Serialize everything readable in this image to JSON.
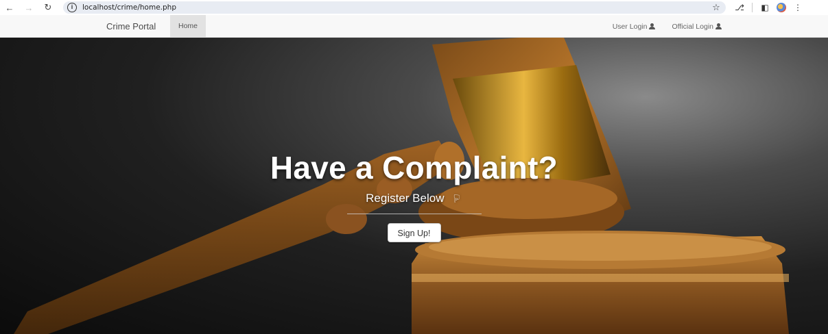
{
  "browser": {
    "url": "localhost/crime/home.php",
    "icons": [
      "back-arrow-icon",
      "forward-arrow-icon",
      "reload-icon",
      "site-info-icon",
      "bookmark-star-icon",
      "extensions-icon",
      "side-panel-icon",
      "profile-icon",
      "menu-icon"
    ]
  },
  "navbar": {
    "brand": "Crime Portal",
    "home": "Home",
    "user_login": "User Login",
    "official_login": "Official Login"
  },
  "hero": {
    "title": "Have a Complaint?",
    "subtitle": "Register Below",
    "signup_label": "Sign Up!"
  },
  "colors": {
    "navbar_bg": "#f8f8f8",
    "home_active_bg": "#e2e2e2",
    "hero_text": "#ffffff"
  }
}
